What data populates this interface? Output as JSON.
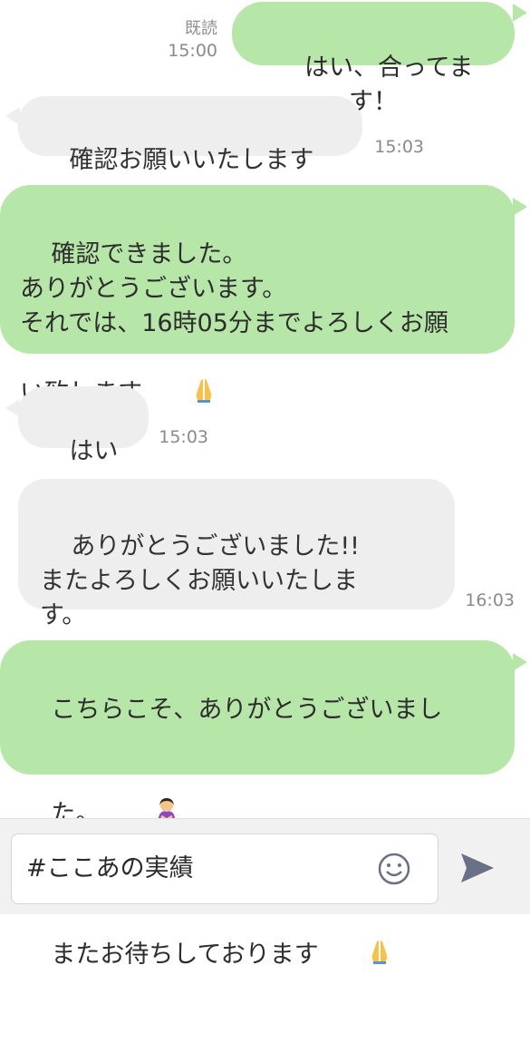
{
  "messages": [
    {
      "dir": "out",
      "text": "はい、合ってます！",
      "read": "既読",
      "time": "15:00",
      "emoji": ""
    },
    {
      "dir": "in",
      "text": "確認お願いいたします",
      "time": "15:03",
      "emoji": "woman-bowing-icon"
    },
    {
      "dir": "out",
      "text": "確認できました。\nありがとうございます。\nそれでは、16時05分までよろしくお願\nい致します",
      "time": "",
      "emoji": "folded-hands-icon"
    },
    {
      "dir": "in",
      "text": "はい",
      "time": "15:03",
      "emoji": "smiling-face-icon"
    },
    {
      "dir": "in",
      "text": "ありがとうございました!!\nまたよろしくお願いいたしま\nす。",
      "time": "16:03",
      "emoji": ""
    },
    {
      "dir": "out",
      "text_line1": "こちらこそ、ありがとうございまし",
      "text_line2": "た。",
      "text_line3": "またお待ちしております",
      "time": "",
      "emoji": "woman-bowing-icon"
    }
  ],
  "input": {
    "value": "#ここあの実績",
    "emoji_icon": "smiley-icon",
    "send_icon": "send-icon"
  },
  "colors": {
    "outgoing_bubble": "#b6e6a8",
    "incoming_bubble": "#eeeeee",
    "meta_text": "#8a8a8a",
    "send_icon": "#6a7085"
  }
}
